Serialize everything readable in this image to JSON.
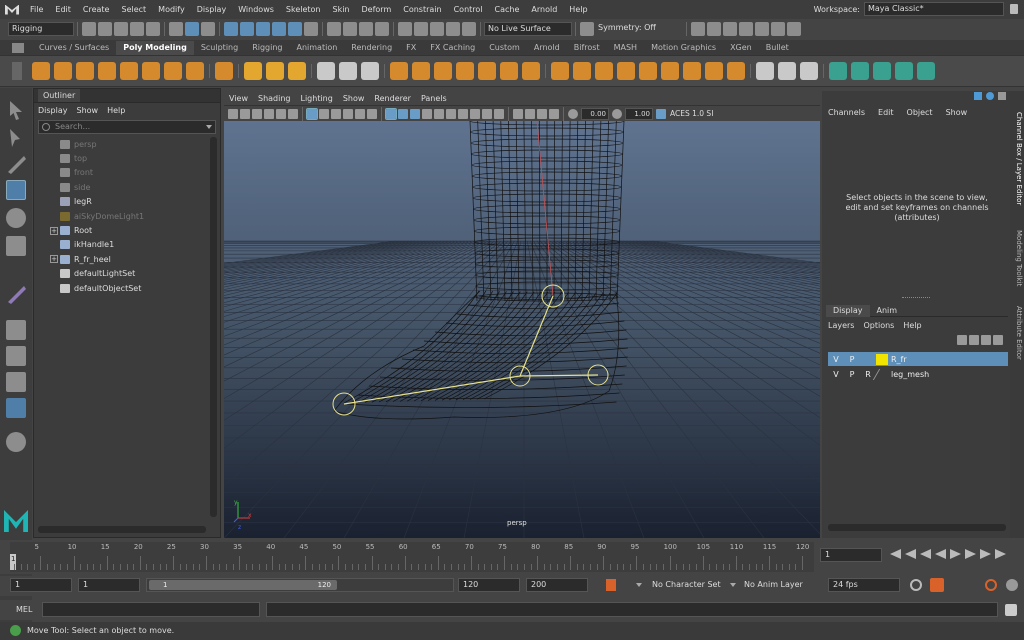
{
  "menubar": {
    "items": [
      "File",
      "Edit",
      "Create",
      "Select",
      "Modify",
      "Display",
      "Windows",
      "Skeleton",
      "Skin",
      "Deform",
      "Constrain",
      "Control",
      "Cache",
      "Arnold",
      "Help"
    ],
    "workspace_label": "Workspace:",
    "workspace_value": "Maya Classic*"
  },
  "status_line": {
    "menuset": "Rigging",
    "live_surface": "No Live Surface",
    "symmetry": "Symmetry: Off"
  },
  "shelf": {
    "tabs": [
      "Curves / Surfaces",
      "Poly Modeling",
      "Sculpting",
      "Rigging",
      "Animation",
      "Rendering",
      "FX",
      "FX Caching",
      "Custom",
      "Arnold",
      "Bifrost",
      "MASH",
      "Motion Graphics",
      "XGen",
      "Bullet"
    ],
    "active": "Poly Modeling"
  },
  "outliner": {
    "title": "Outliner",
    "menus": [
      "Display",
      "Show",
      "Help"
    ],
    "search_placeholder": "Search...",
    "rows": [
      {
        "label": "persp",
        "dim": true
      },
      {
        "label": "top",
        "dim": true
      },
      {
        "label": "front",
        "dim": true
      },
      {
        "label": "side",
        "dim": true
      },
      {
        "label": "legR",
        "dim": false
      },
      {
        "label": "aiSkyDomeLight1",
        "dim": true
      },
      {
        "label": "Root",
        "dim": false,
        "expand": true
      },
      {
        "label": "ikHandle1",
        "dim": false
      },
      {
        "label": "R_fr_heel",
        "dim": false,
        "expand": true
      },
      {
        "label": "defaultLightSet",
        "dim": false
      },
      {
        "label": "defaultObjectSet",
        "dim": false
      }
    ]
  },
  "viewport": {
    "menus": [
      "View",
      "Shading",
      "Lighting",
      "Show",
      "Renderer",
      "Panels"
    ],
    "exposure": "0.00",
    "gamma": "1.00",
    "colorspace": "ACES 1.0 SI",
    "camera_label": "persp",
    "axis_x": "x",
    "axis_y": "y",
    "axis_z": "z"
  },
  "channel_box": {
    "menus": [
      "Channels",
      "Edit",
      "Object",
      "Show"
    ],
    "message": "Select objects in the scene to view, edit and set keyframes on channels (attributes)",
    "side_tabs": [
      "Channel Box / Layer Editor",
      "Modeling Toolkit",
      "Attribute Editor"
    ]
  },
  "layer_editor": {
    "tabs": [
      "Display",
      "Anim"
    ],
    "menus": [
      "Layers",
      "Options",
      "Help"
    ],
    "layers": [
      {
        "v": "V",
        "p": "P",
        "r": "",
        "name": "R_fr",
        "color": "#f0e400",
        "selected": true
      },
      {
        "v": "V",
        "p": "P",
        "r": "R",
        "name": "leg_mesh",
        "color": "",
        "selected": false
      }
    ]
  },
  "timeline": {
    "ticks": [
      "5",
      "10",
      "15",
      "20",
      "25",
      "30",
      "35",
      "40",
      "45",
      "50",
      "55",
      "60",
      "65",
      "70",
      "75",
      "80",
      "85",
      "90",
      "95",
      "100",
      "105",
      "110",
      "115",
      "120"
    ],
    "start_marker": "1",
    "current_frame": "1"
  },
  "range": {
    "start": "1",
    "inner_start": "1",
    "slider_start": "1",
    "slider_end": "120",
    "inner_end": "120",
    "end": "200",
    "character_set": "No Character Set",
    "anim_layer": "No Anim Layer",
    "fps": "24 fps"
  },
  "command": {
    "label": "MEL"
  },
  "help_line": {
    "text": "Move Tool: Select an object to move."
  }
}
